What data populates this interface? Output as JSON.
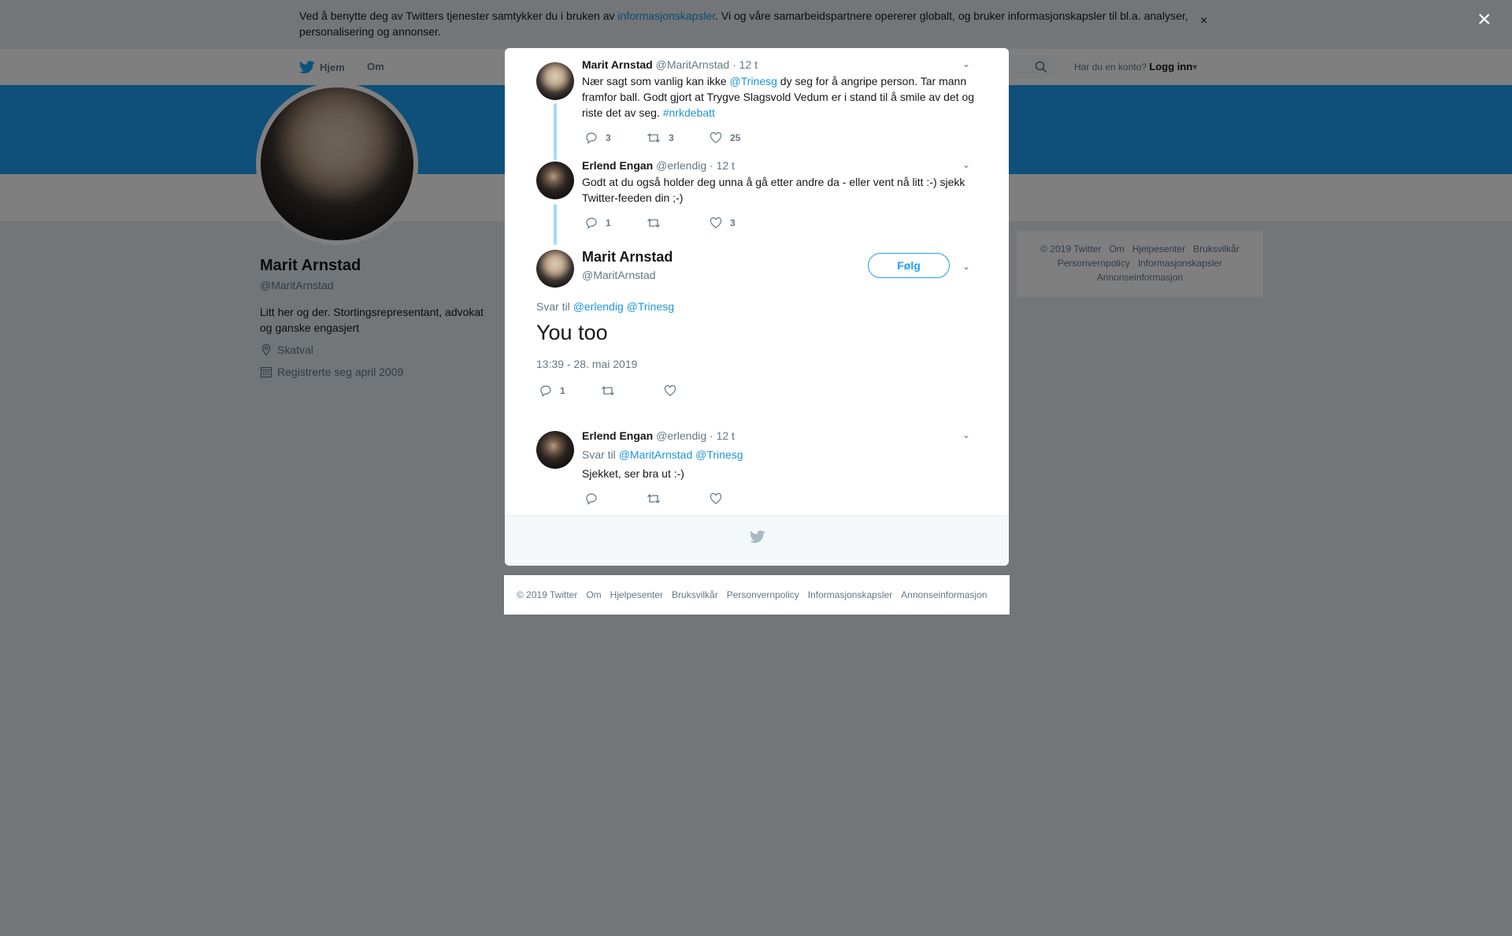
{
  "cookie": {
    "text_before": "Ved å benytte deg av Twitters tjenester samtykker du i bruken av ",
    "link": "informasjonskapsler",
    "text_after": ". Vi og våre samarbeidspartnere opererer globalt, og bruker informasjonskapsler til bl.a. analyser, personalisering og annonser.",
    "close": "×"
  },
  "nav": {
    "home": "Hjem",
    "about": "Om",
    "login_prompt": "Har du en konto?",
    "login": "Logg inn"
  },
  "profile": {
    "name": "Marit Arnstad",
    "handle": "@MaritArnstad",
    "bio": "Litt her og der. Stortingsrepresentant, advokat og ganske engasjert",
    "location": "Skatval",
    "joined": "Registrerte seg april 2009"
  },
  "sidebar_footer": [
    "© 2019 Twitter",
    "Om",
    "Hjelpesenter",
    "Bruksvilkår",
    "Personvernpolicy",
    "Informasjonskapsler",
    "Annonseinformasjon"
  ],
  "modal_close": "×",
  "tweets": [
    {
      "name": "Marit Arnstad",
      "handle": "@MaritArnstad",
      "time": "· 12 t",
      "text_1": "Nær sagt som vanlig kan ikke ",
      "mention": "@Trinesg",
      "text_2": " dy seg for å angripe person. Tar mann framfor ball. Godt gjort at Trygve Slagsvold Vedum er i stand til å smile av det og riste det av seg. ",
      "hashtag": "#nrkdebatt",
      "replies": "3",
      "retweets": "3",
      "likes": "25"
    },
    {
      "name": "Erlend Engan",
      "handle": "@erlendig",
      "time": "· 12 t",
      "text": "Godt at du også holder deg unna å gå etter andre da - eller vent nå litt :-) sjekk Twitter-feeden din ;-)",
      "replies": "1",
      "retweets": "",
      "likes": "3"
    }
  ],
  "main_tweet": {
    "name": "Marit Arnstad",
    "handle": "@MaritArnstad",
    "follow": "Følg",
    "reply_prefix": "Svar til",
    "reply_mentions": "@erlendig @Trinesg",
    "text": "You too",
    "date": "13:39 - 28. mai 2019",
    "replies": "1",
    "retweets": "",
    "likes": ""
  },
  "reply_tweet": {
    "name": "Erlend Engan",
    "handle": "@erlendig",
    "time": "· 12 t",
    "reply_prefix": "Svar til",
    "reply_mentions": "@MaritArnstad @Trinesg",
    "text": "Sjekket, ser bra ut :-)"
  },
  "footer": [
    "© 2019 Twitter",
    "Om",
    "Hjelpesenter",
    "Bruksvilkår",
    "Personvernpolicy",
    "Informasjonskapsler",
    "Annonseinformasjon"
  ]
}
